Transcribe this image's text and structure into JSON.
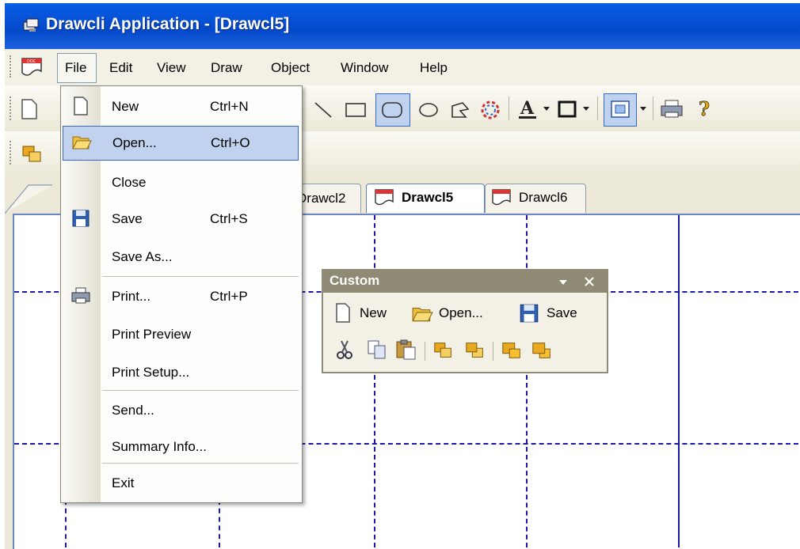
{
  "window": {
    "title": "Drawcli Application - [Drawcl5]"
  },
  "menubar": {
    "items": [
      {
        "label": "File"
      },
      {
        "label": "Edit"
      },
      {
        "label": "View"
      },
      {
        "label": "Draw"
      },
      {
        "label": "Object"
      },
      {
        "label": "Window"
      },
      {
        "label": "Help"
      }
    ]
  },
  "toolbar": {
    "icons": [
      "new-document-icon",
      "line-tool-icon",
      "rectangle-tool-icon",
      "rounded-rectangle-tool-icon",
      "ellipse-tool-icon",
      "polygon-tool-icon",
      "color-wheel-icon",
      "font-color-icon",
      "line-color-icon",
      "fill-icon",
      "print-icon",
      "help-icon"
    ],
    "selected_tool": "rounded-rectangle-tool-icon"
  },
  "tabs": [
    {
      "label": "Drawcl2"
    },
    {
      "label": "Drawcl5",
      "active": true
    },
    {
      "label": "Drawcl6"
    }
  ],
  "file_menu": {
    "items": [
      {
        "label": "New",
        "shortcut": "Ctrl+N",
        "icon": "new-document-icon"
      },
      {
        "label": "Open...",
        "shortcut": "Ctrl+O",
        "icon": "open-folder-icon",
        "highlighted": true
      },
      {
        "label": "Close",
        "shortcut": ""
      },
      {
        "label": "Save",
        "shortcut": "Ctrl+S",
        "icon": "save-disk-icon"
      },
      {
        "label": "Save As...",
        "shortcut": ""
      },
      {
        "label": "Print...",
        "shortcut": "Ctrl+P",
        "icon": "print-icon"
      },
      {
        "label": "Print Preview",
        "shortcut": ""
      },
      {
        "label": "Print Setup...",
        "shortcut": ""
      },
      {
        "label": "Send...",
        "shortcut": ""
      },
      {
        "label": "Summary Info...",
        "shortcut": ""
      },
      {
        "label": "Exit",
        "shortcut": ""
      }
    ]
  },
  "custom_toolbar": {
    "title": "Custom",
    "buttons": [
      {
        "label": "New",
        "icon": "new-document-icon"
      },
      {
        "label": "Open...",
        "icon": "open-folder-icon"
      },
      {
        "label": "Save",
        "icon": "save-disk-icon"
      }
    ],
    "icon_row": [
      "cut-icon",
      "copy-icon",
      "paste-icon",
      "bring-forward-icon",
      "send-backward-icon",
      "bring-to-front-icon",
      "send-to-back-icon"
    ]
  },
  "colors": {
    "titlebar": "#0349c9",
    "menu_highlight": "#c1d2ee",
    "grid_line": "#1a1aa6"
  }
}
